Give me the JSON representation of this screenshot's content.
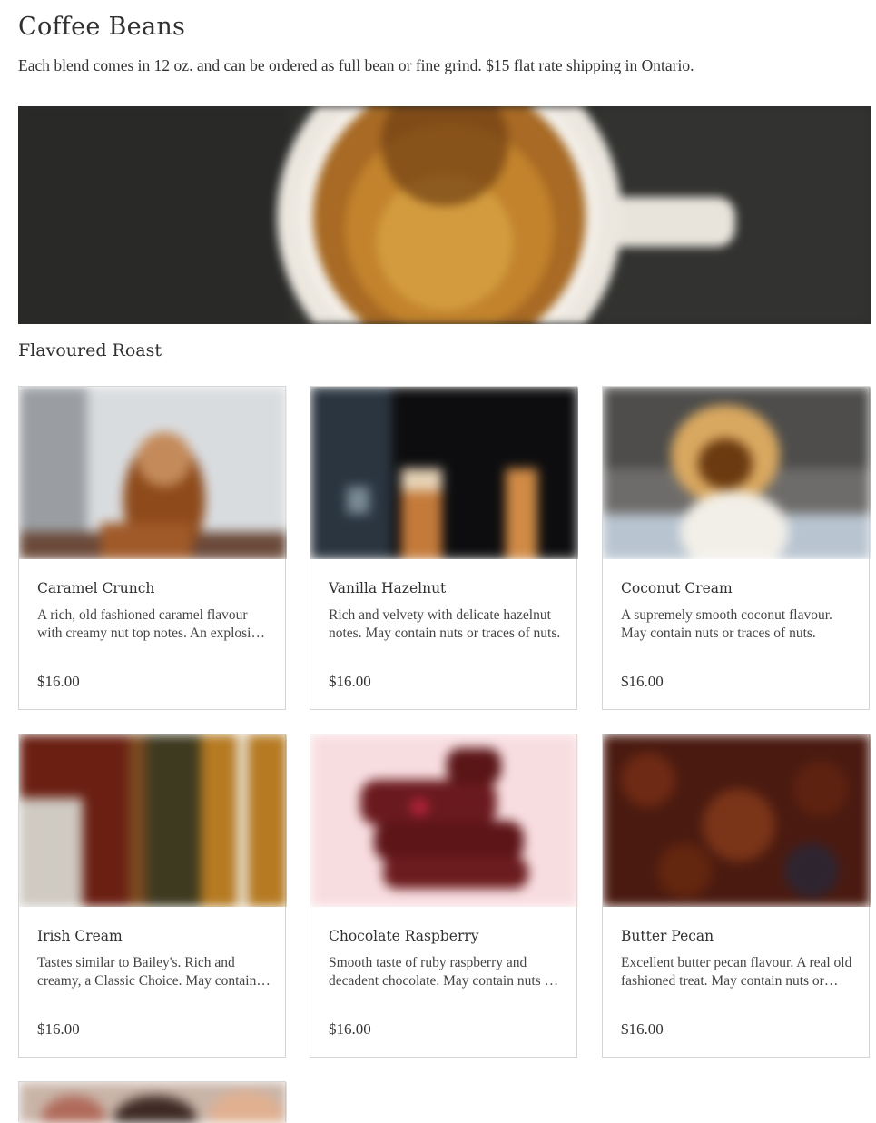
{
  "page": {
    "title": "Coffee Beans",
    "intro": "Each blend comes in 12 oz. and can be ordered as full bean or fine grind. $15 flat rate shipping in Ontario.",
    "section_title": "Flavoured Roast"
  },
  "products": [
    {
      "name": "Caramel Crunch",
      "description": "A rich, old fashioned caramel flavour with creamy nut top notes. An explosion of flavour.",
      "price": "$16.00",
      "image_icon": "caramel-drink-photo"
    },
    {
      "name": "Vanilla Hazelnut",
      "description": "Rich and velvety with delicate hazelnut notes.  May contain nuts or traces of nuts.",
      "price": "$16.00",
      "image_icon": "latte-glasses-photo"
    },
    {
      "name": "Coconut Cream",
      "description": "A supremely smooth coconut flavour. May contain nuts or traces of nuts.",
      "price": "$16.00",
      "image_icon": "coconut-photo"
    },
    {
      "name": "Irish Cream",
      "description": "Tastes similar to Bailey's. Rich and creamy, a Classic Choice.  May contain nuts or traces of nuts.",
      "price": "$16.00",
      "image_icon": "irish-cream-photo"
    },
    {
      "name": "Chocolate Raspberry",
      "description": "Smooth taste of ruby raspberry and decadent chocolate. May contain nuts or traces of nuts.",
      "price": "$16.00",
      "image_icon": "chocolate-raspberry-photo"
    },
    {
      "name": "Butter Pecan",
      "description": "Excellent butter pecan flavour. A real old fashioned treat. May contain nuts or traces of nuts.",
      "price": "$16.00",
      "image_icon": "pecans-photo"
    }
  ],
  "colors": {
    "text": "#333333",
    "card_border": "#d5d5d5",
    "hero_background": "#2c2c2a"
  }
}
